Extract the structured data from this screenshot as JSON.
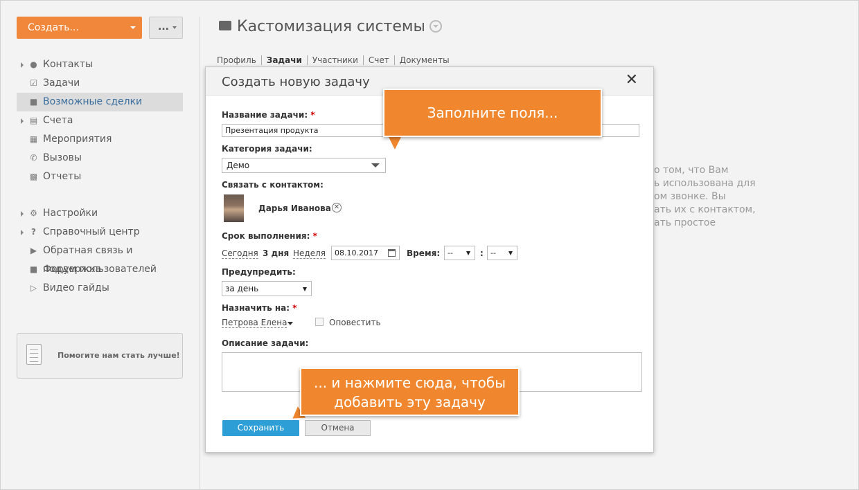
{
  "toolbar": {
    "create_label": "Создать...",
    "more_label": "..."
  },
  "sidebar": {
    "items": [
      {
        "label": "Контакты",
        "icon": "user-icon",
        "expandable": true
      },
      {
        "label": "Задачи",
        "icon": "checkbox-icon",
        "expandable": false
      },
      {
        "label": "Возможные сделки",
        "icon": "briefcase-icon",
        "expandable": false,
        "active": true
      },
      {
        "label": "Счета",
        "icon": "document-icon",
        "expandable": true
      },
      {
        "label": "Мероприятия",
        "icon": "calendar-icon",
        "expandable": false
      },
      {
        "label": "Вызовы",
        "icon": "phone-icon",
        "expandable": false
      },
      {
        "label": "Отчеты",
        "icon": "bar-chart-icon",
        "expandable": false
      }
    ],
    "secondary": [
      {
        "label": "Настройки",
        "icon": "gear-icon",
        "expandable": true
      },
      {
        "label": "Справочный центр",
        "icon": "question-icon",
        "expandable": true
      },
      {
        "label": "Обратная связь и поддержка",
        "icon": "megaphone-icon",
        "expandable": false
      },
      {
        "label": "Форум пользователей",
        "icon": "chat-bubble-icon",
        "expandable": false
      },
      {
        "label": "Видео гайды",
        "icon": "video-play-icon",
        "expandable": false
      }
    ],
    "feedback_label": "Помогите нам стать лучше!"
  },
  "page": {
    "title": "Кастомизация системы",
    "tabs": [
      "Профиль",
      "Задачи",
      "Участники",
      "Счет",
      "Документы"
    ],
    "active_tab": "Задачи",
    "background_text": [
      "о том, что Вам",
      "ь использована для",
      "ом звонке. Вы",
      "ать их с контактом,",
      "ать простое"
    ]
  },
  "modal": {
    "title": "Создать новую задачу",
    "close_glyph": "✕",
    "task_name_label": "Название задачи:",
    "task_name_value": "Презентация продукта",
    "category_label": "Категория задачи:",
    "category_value": "Демо",
    "contact_label": "Связать с контактом:",
    "contact_name": "Дарья Иванова",
    "due_label": "Срок выполнения:",
    "due_today": "Сегодня",
    "due_3days": "3 дня",
    "due_week": "Неделя",
    "due_date": "08.10.2017",
    "time_label": "Время:",
    "hour_value": "--",
    "minute_value": "--",
    "time_separator": ":",
    "remind_label": "Предупредить:",
    "remind_value": "за день",
    "assign_label": "Назначить на:",
    "assign_value": "Петрова Елена",
    "notify_label": "Оповестить",
    "description_label": "Описание задачи:",
    "description_value": "",
    "required_mark": "*",
    "save_label": "Сохранить",
    "cancel_label": "Отмена"
  },
  "tooltips": {
    "fill_fields": "Заполните поля...",
    "press_here_line1": "... и нажмите сюда, чтобы",
    "press_here_line2": "добавить эту задачу"
  },
  "colors": {
    "accent_orange": "#f0872f",
    "save_blue": "#2d9fd6",
    "active_nav_text": "#3a6e9e"
  }
}
